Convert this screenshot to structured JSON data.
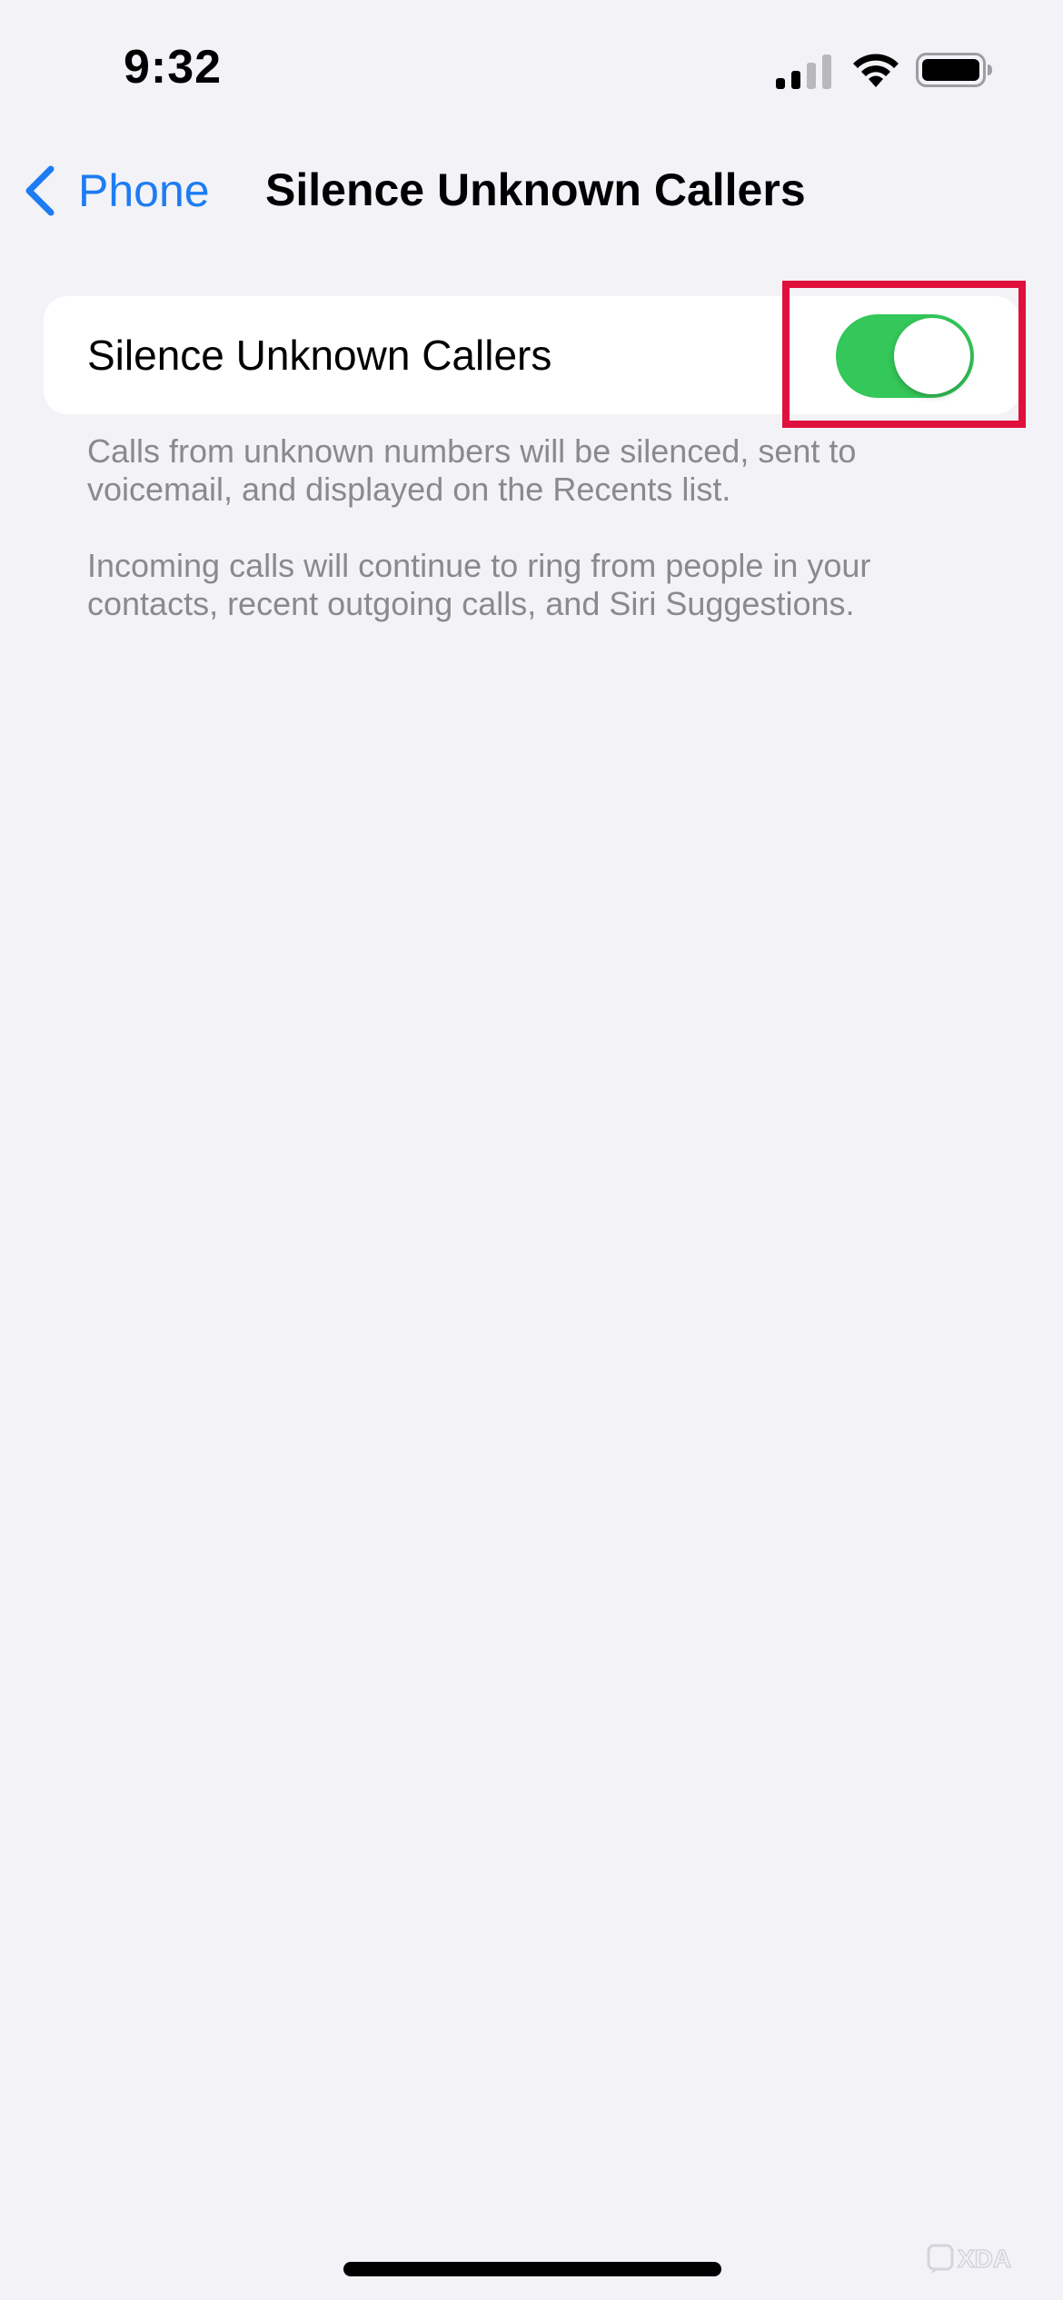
{
  "status_bar": {
    "time": "9:32",
    "icons": [
      "cellular-signal-icon",
      "wifi-icon",
      "battery-icon"
    ]
  },
  "nav": {
    "back_label": "Phone",
    "title": "Silence Unknown Callers"
  },
  "settings": {
    "row_label": "Silence Unknown Callers",
    "toggle_on": true,
    "footer_1": "Calls from unknown numbers will be silenced, sent to voicemail, and displayed on the Recents list.",
    "footer_2": "Incoming calls will continue to ring from people in your contacts, recent outgoing calls, and Siri Suggestions."
  },
  "colors": {
    "accent": "#1d7cf2",
    "toggle_on": "#34c759",
    "highlight": "#e0103d",
    "background": "#f2f2f7"
  },
  "watermark": {
    "text": "XDA"
  }
}
